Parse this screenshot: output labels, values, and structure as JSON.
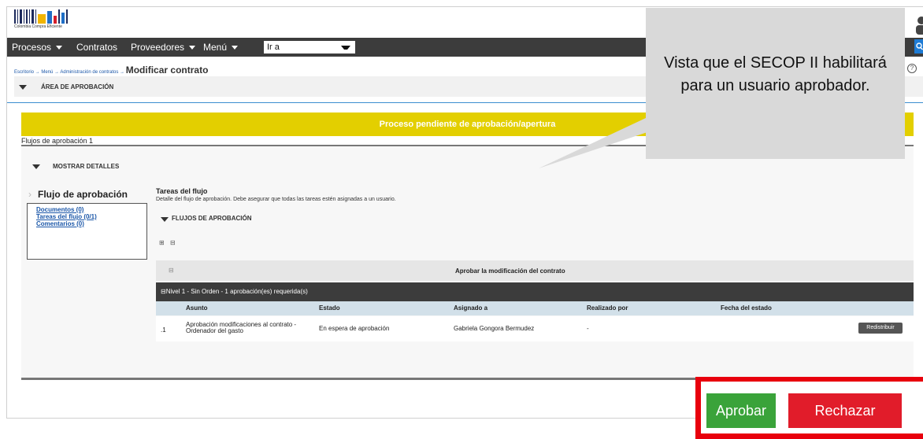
{
  "header": {
    "logo_tagline": "Colombia Compra Eficiente"
  },
  "nav": {
    "items": [
      "Procesos",
      "Contratos",
      "Proveedores",
      "Menú"
    ],
    "goto_value": "Ir a"
  },
  "breadcrumb": {
    "path": "Escritorio → Menú → Administración de contratos →",
    "current": "Modificar contrato"
  },
  "approval_area": {
    "title": "ÁREA DE APROBACIÓN",
    "banner": "Proceso pendiente de aprobación/apertura",
    "flows_label": "Flujos de aprobación 1",
    "details_toggle": "MOSTRAR DETALLES"
  },
  "sidebar": {
    "title": "Flujo de aprobación",
    "links": [
      "Documentos (0)",
      "Tareas del flujo (0/1)",
      "Comentarios (0)"
    ]
  },
  "tasks": {
    "title": "Tareas del flujo",
    "description": "Detalle del flujo de aprobación. Debe asegurar que todas las tareas estén asignadas a un usuario.",
    "section_title": "FLUJOS DE APROBACIÓN",
    "expand_all": "⊞",
    "collapse_all": "⊟",
    "group_toggle": "⊟",
    "group_title": "Aprobar la modificación del contrato",
    "level_label": "⊟Nivel 1 - Sin Orden - 1 aprobación(es) requerida(s)",
    "columns": [
      "Asunto",
      "Estado",
      "Asignado a",
      "Realizado por",
      "Fecha del estado"
    ],
    "rows": [
      {
        "index": ".1",
        "asunto": "Aprobación modificaciones al contrato - Ordenador del gasto",
        "estado": "En espera de aprobación",
        "asignado": "Gabriela Gongora Bermudez",
        "realizado": "-",
        "fecha": "",
        "action": "Redistribuir"
      }
    ]
  },
  "callout": {
    "text": "Vista que el SECOP II habilitará para un usuario aprobador."
  },
  "actions": {
    "approve": "Aprobar",
    "reject": "Rechazar"
  },
  "colors": {
    "banner_yellow": "#e3cf00",
    "navbar": "#3c3c3c",
    "approve_green": "#3aa33a",
    "reject_red": "#e11c2a",
    "highlight_red": "#e8000d",
    "link_blue": "#1a56a8"
  }
}
